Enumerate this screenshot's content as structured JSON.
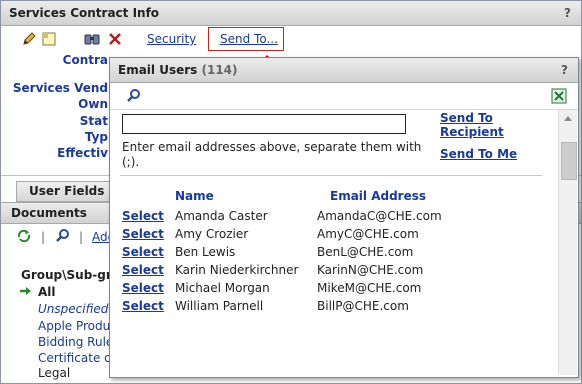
{
  "main": {
    "title": "Services Contract Info",
    "help": "?",
    "toolbar": {
      "security": "Security",
      "send_to": "Send To..."
    },
    "fields": {
      "contract": "Contra",
      "vendor": "Services Vend",
      "owner": "Own",
      "status": "Stat",
      "type": "Typ",
      "effective": "Effectiv"
    },
    "tabs": {
      "user_fields": "User Fields"
    },
    "documents": {
      "header": "Documents",
      "add_link": "Add",
      "group_label": "Group\\Sub-gr",
      "all_label": "All",
      "items": [
        "Unspecified",
        "Apple Produc",
        "Bidding Rule",
        "Certificate o",
        "Legal"
      ]
    }
  },
  "popup": {
    "title": "Email Users",
    "count": "(114)",
    "help": "?",
    "email_input": {
      "value": "",
      "placeholder": ""
    },
    "hint": "Enter email addresses above, separate them with (;).",
    "send_to_recipient": "Send To Recipient",
    "send_to_me": "Send To Me",
    "columns": {
      "name": "Name",
      "email": "Email Address"
    },
    "select_label": "Select",
    "users": [
      {
        "name": "Amanda Caster",
        "email": "AmandaC@CHE.com"
      },
      {
        "name": "Amy Crozier",
        "email": "AmyC@CHE.com"
      },
      {
        "name": "Ben Lewis",
        "email": "BenL@CHE.com"
      },
      {
        "name": "Karin Niederkirchner",
        "email": "KarinN@CHE.com"
      },
      {
        "name": "Michael Morgan",
        "email": "MikeM@CHE.com"
      },
      {
        "name": "William Parnell",
        "email": "BillP@CHE.com"
      }
    ]
  },
  "colors": {
    "link": "#1a3a99",
    "highlight_box": "#cc2222",
    "arrow": "#cc1111",
    "excel_green": "#1e7a3a"
  },
  "icons": [
    "pencil-icon",
    "note-icon",
    "binoculars-icon",
    "delete-icon",
    "refresh-icon",
    "search-icon",
    "excel-icon",
    "arrow-right-icon"
  ]
}
